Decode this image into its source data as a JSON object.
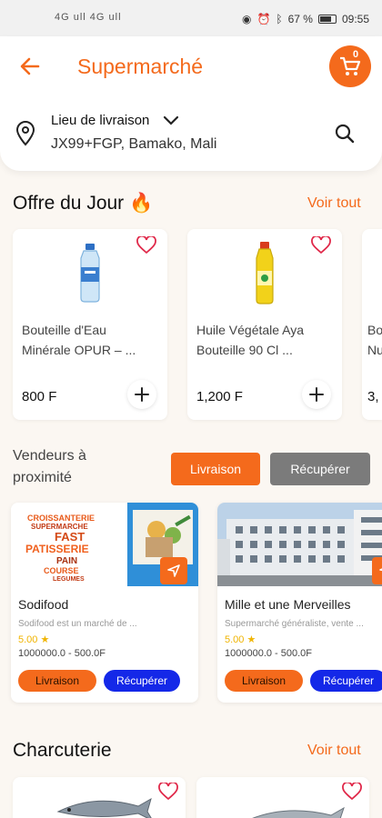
{
  "status_bar": {
    "signal": "4G ull 4G ull",
    "battery_percent": "67 %",
    "time": "09:55"
  },
  "header": {
    "title": "Supermarché",
    "cart_count": "0",
    "location_title": "Lieu de livraison",
    "address": "JX99+FGP, Bamako, Mali"
  },
  "offers": {
    "title": "Offre du Jour 🔥",
    "see_all": "Voir tout",
    "products": [
      {
        "name": "Bouteille d'Eau Minérale OPUR – ...",
        "price": "800 F"
      },
      {
        "name": "Huile Végétale Aya Bouteille 90 Cl ...",
        "price": "1,200 F"
      },
      {
        "name": "Bo Nu",
        "price": "3,"
      }
    ]
  },
  "vendors": {
    "title": "Vendeurs à proximité",
    "delivery_label": "Livraison",
    "pickup_label": "Récupérer",
    "items": [
      {
        "name": "Sodifood",
        "description": "Sodifood est un marché de ...",
        "rating": "5.00",
        "range": "1000000.0  - 500.0F",
        "delivery": "Livraison",
        "pickup": "Récupérer",
        "banner_words": [
          "CROISSANTERIE",
          "SUPERMARCHE",
          "FAST",
          "PATISSERIE",
          "PAIN",
          "COURSE",
          "LEGUMES"
        ]
      },
      {
        "name": "Mille et une Merveilles",
        "description": "Supermarché généraliste, vente ...",
        "rating": "5.00",
        "range": "1000000.0  - 500.0F",
        "delivery": "Livraison",
        "pickup": "Récupérer"
      }
    ]
  },
  "charcuterie": {
    "title": "Charcuterie",
    "see_all": "Voir tout"
  },
  "colors": {
    "accent": "#f46a1c",
    "pickup_pill": "#1428e8",
    "pickup_toggle": "#7b7b7b"
  }
}
